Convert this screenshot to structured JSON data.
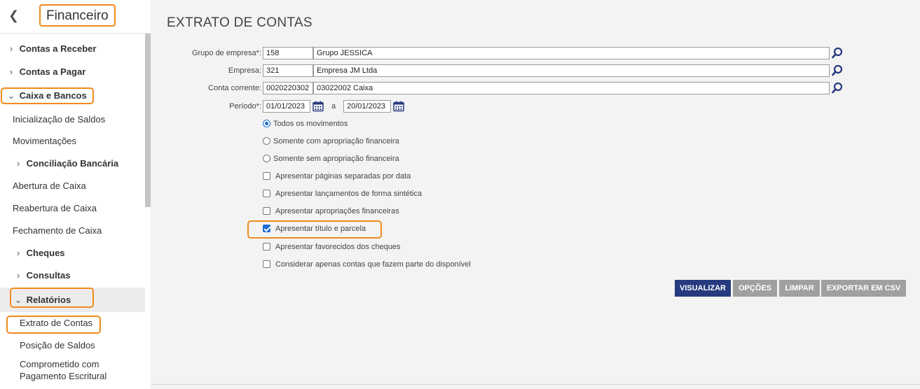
{
  "sidebar": {
    "title": "Financeiro",
    "items": [
      {
        "label": "Contas a Receber"
      },
      {
        "label": "Contas a Pagar"
      },
      {
        "label": "Caixa e Bancos"
      },
      {
        "label": "Inicialização de Saldos"
      },
      {
        "label": "Movimentações"
      },
      {
        "label": "Conciliação Bancária"
      },
      {
        "label": "Abertura de Caixa"
      },
      {
        "label": "Reabertura de Caixa"
      },
      {
        "label": "Fechamento de Caixa"
      },
      {
        "label": "Cheques"
      },
      {
        "label": "Consultas"
      },
      {
        "label": "Relatórios"
      },
      {
        "label": "Extrato de Contas"
      },
      {
        "label": "Posição de Saldos"
      },
      {
        "label": "Comprometido com"
      },
      {
        "label": "Pagamento Escritural"
      }
    ]
  },
  "main": {
    "title": "EXTRATO DE CONTAS",
    "form": {
      "grupo_label": "Grupo de empresa*:",
      "grupo_code": "158",
      "grupo_name": "Grupo JESSICA",
      "empresa_label": "Empresa:",
      "empresa_code": "321",
      "empresa_name": "Empresa JM Ltda",
      "conta_label": "Conta corrente:",
      "conta_code": "0020220302",
      "conta_name": "03022002 Caixa",
      "periodo_label": "Período*:",
      "periodo_start": "01/01/2023",
      "periodo_sep": "a",
      "periodo_end": "20/01/2023"
    },
    "radios": [
      {
        "label": "Todos os movimentos",
        "selected": true
      },
      {
        "label": "Somente com apropriação financeira",
        "selected": false
      },
      {
        "label": "Somente sem apropriação financeira",
        "selected": false
      }
    ],
    "checkboxes": [
      {
        "label": "Apresentar páginas separadas por data",
        "checked": false
      },
      {
        "label": "Apresentar lançamentos de forma sintética",
        "checked": false
      },
      {
        "label": "Apresentar apropriações financeiras",
        "checked": false
      },
      {
        "label": "Apresentar título e parcela",
        "checked": true
      },
      {
        "label": "Apresentar favorecidos dos cheques",
        "checked": false
      },
      {
        "label": "Considerar apenas contas que fazem parte do disponível",
        "checked": false
      }
    ],
    "buttons": {
      "visualizar": "VISUALIZAR",
      "opcoes": "OPÇÕES",
      "limpar": "LIMPAR",
      "exportar": "EXPORTAR EM CSV"
    }
  },
  "colors": {
    "highlight": "#f08a1c",
    "primary_button": "#263a7e",
    "secondary_button": "#a0a0a0",
    "checkbox_accent": "#1a6fd6"
  }
}
